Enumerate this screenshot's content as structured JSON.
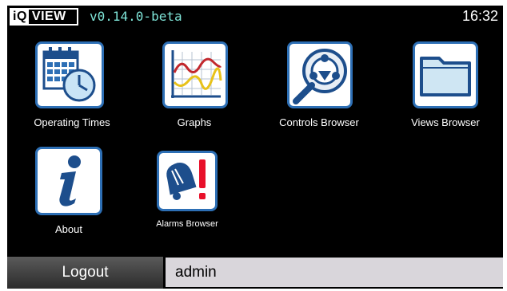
{
  "header": {
    "logo_iq": "iQ",
    "logo_view": "VIEW",
    "version": "v0.14.0-beta",
    "time": "16:32"
  },
  "apps": [
    {
      "label": "Operating Times",
      "icon": "calendar-clock-icon"
    },
    {
      "label": "Graphs",
      "icon": "line-graph-icon"
    },
    {
      "label": "Controls Browser",
      "icon": "network-search-icon"
    },
    {
      "label": "Views Browser",
      "icon": "folder-icon"
    },
    {
      "label": "About",
      "icon": "info-icon"
    },
    {
      "label": "Alarms Browser",
      "icon": "alarm-bell-icon"
    }
  ],
  "footer": {
    "logout_label": "Logout",
    "username": "admin"
  },
  "colors": {
    "background": "#000000",
    "version_text": "#7fe5d8",
    "tile_border": "#2d6fb5",
    "alarm_red": "#e8102a"
  }
}
